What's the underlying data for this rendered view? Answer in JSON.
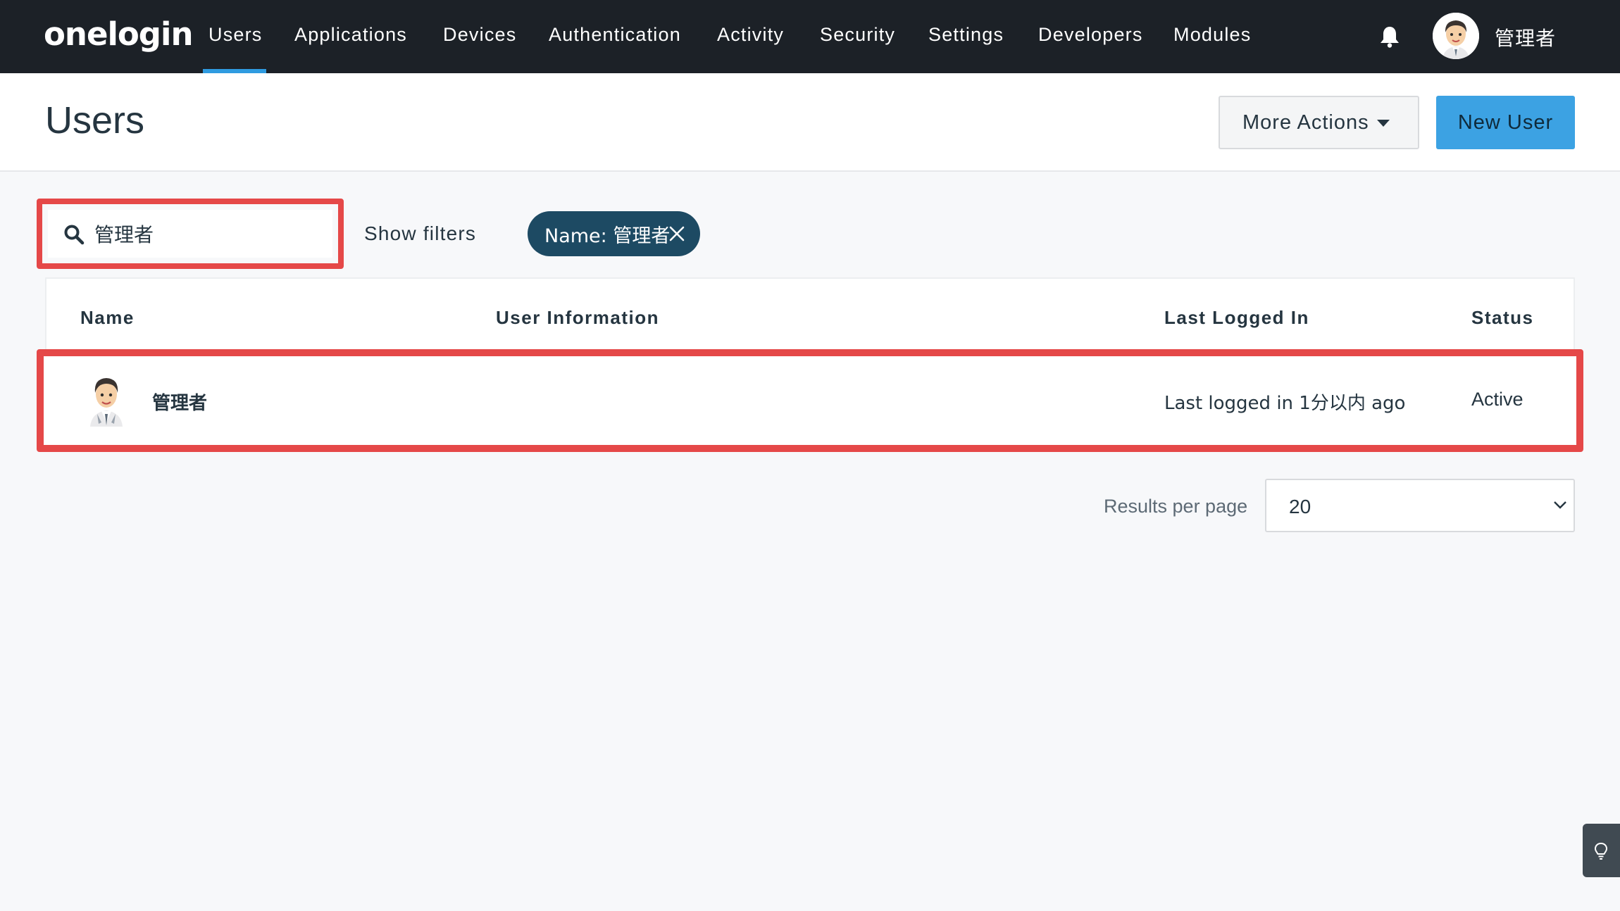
{
  "brand": {
    "logo_text": "onelogin"
  },
  "nav": {
    "items": [
      {
        "label": "Users",
        "active": true
      },
      {
        "label": "Applications"
      },
      {
        "label": "Devices"
      },
      {
        "label": "Authentication"
      },
      {
        "label": "Activity"
      },
      {
        "label": "Security"
      },
      {
        "label": "Settings"
      },
      {
        "label": "Developers"
      },
      {
        "label": "Modules"
      }
    ],
    "notification_icon": "bell-icon",
    "current_user": "管理者",
    "active_color": "#2f9be0"
  },
  "header": {
    "title": "Users",
    "more_actions_label": "More Actions",
    "new_user_label": "New User"
  },
  "search": {
    "value": "管理者",
    "icon": "search-icon",
    "show_filters_label": "Show filters",
    "active_filter_chip": "Name: 管理者"
  },
  "table": {
    "columns": [
      "Name",
      "User Information",
      "Last Logged In",
      "Status"
    ],
    "rows": [
      {
        "name": "管理者",
        "user_information": "",
        "last_logged_in": "Last logged in 1分以内 ago",
        "status": "Active"
      }
    ]
  },
  "pagination": {
    "results_per_page_label": "Results per page",
    "results_per_page_value": "20"
  },
  "colors": {
    "nav_bg": "#1c2127",
    "primary_button": "#3ca2e3",
    "chip_bg": "#1d4a63",
    "highlight": "#e54848"
  },
  "help_icon": "lightbulb-icon"
}
